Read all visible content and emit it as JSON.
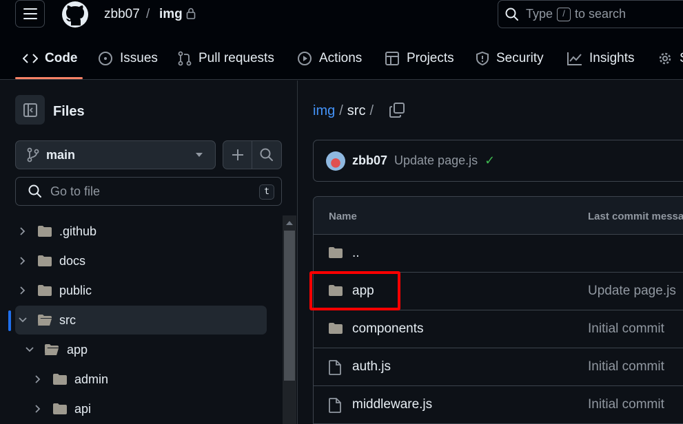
{
  "header": {
    "owner": "zbb07",
    "separator": "/",
    "repo": "img",
    "search_prefix": "Type",
    "search_key": "/",
    "search_suffix": "to search"
  },
  "tabs": [
    {
      "label": "Code",
      "icon": "code-icon",
      "active": true
    },
    {
      "label": "Issues",
      "icon": "issue-icon"
    },
    {
      "label": "Pull requests",
      "icon": "pull-request-icon"
    },
    {
      "label": "Actions",
      "icon": "play-icon"
    },
    {
      "label": "Projects",
      "icon": "table-icon"
    },
    {
      "label": "Security",
      "icon": "shield-icon"
    },
    {
      "label": "Insights",
      "icon": "graph-icon"
    },
    {
      "label": "S",
      "icon": "gear-icon"
    }
  ],
  "sidebar": {
    "title": "Files",
    "branch": "main",
    "goto_placeholder": "Go to file",
    "goto_key": "t",
    "tree": [
      {
        "label": ".github",
        "expanded": false,
        "depth": 0
      },
      {
        "label": "docs",
        "expanded": false,
        "depth": 0
      },
      {
        "label": "public",
        "expanded": false,
        "depth": 0
      },
      {
        "label": "src",
        "expanded": true,
        "depth": 0,
        "selected": true
      },
      {
        "label": "app",
        "expanded": true,
        "depth": 1
      },
      {
        "label": "admin",
        "expanded": false,
        "depth": 2
      },
      {
        "label": "api",
        "expanded": false,
        "depth": 2
      }
    ]
  },
  "main": {
    "path": {
      "root": "img",
      "segment": "src",
      "sep": "/"
    },
    "commit": {
      "user": "zbb07",
      "message": "Update page.js",
      "status": "✓"
    },
    "table": {
      "col_name": "Name",
      "col_message": "Last commit messa",
      "rows": [
        {
          "name": "..",
          "type": "folder",
          "message": ""
        },
        {
          "name": "app",
          "type": "folder",
          "message": "Update page.js"
        },
        {
          "name": "components",
          "type": "folder",
          "message": "Initial commit"
        },
        {
          "name": "auth.js",
          "type": "file",
          "message": "Initial commit"
        },
        {
          "name": "middleware.js",
          "type": "file",
          "message": "Initial commit"
        }
      ]
    }
  },
  "colors": {
    "background": "#0d1117",
    "header_bg": "#010409",
    "link": "#4493f8",
    "active_tab_underline": "#f78166",
    "highlight_box": "#ff0000",
    "success": "#3fb950"
  }
}
